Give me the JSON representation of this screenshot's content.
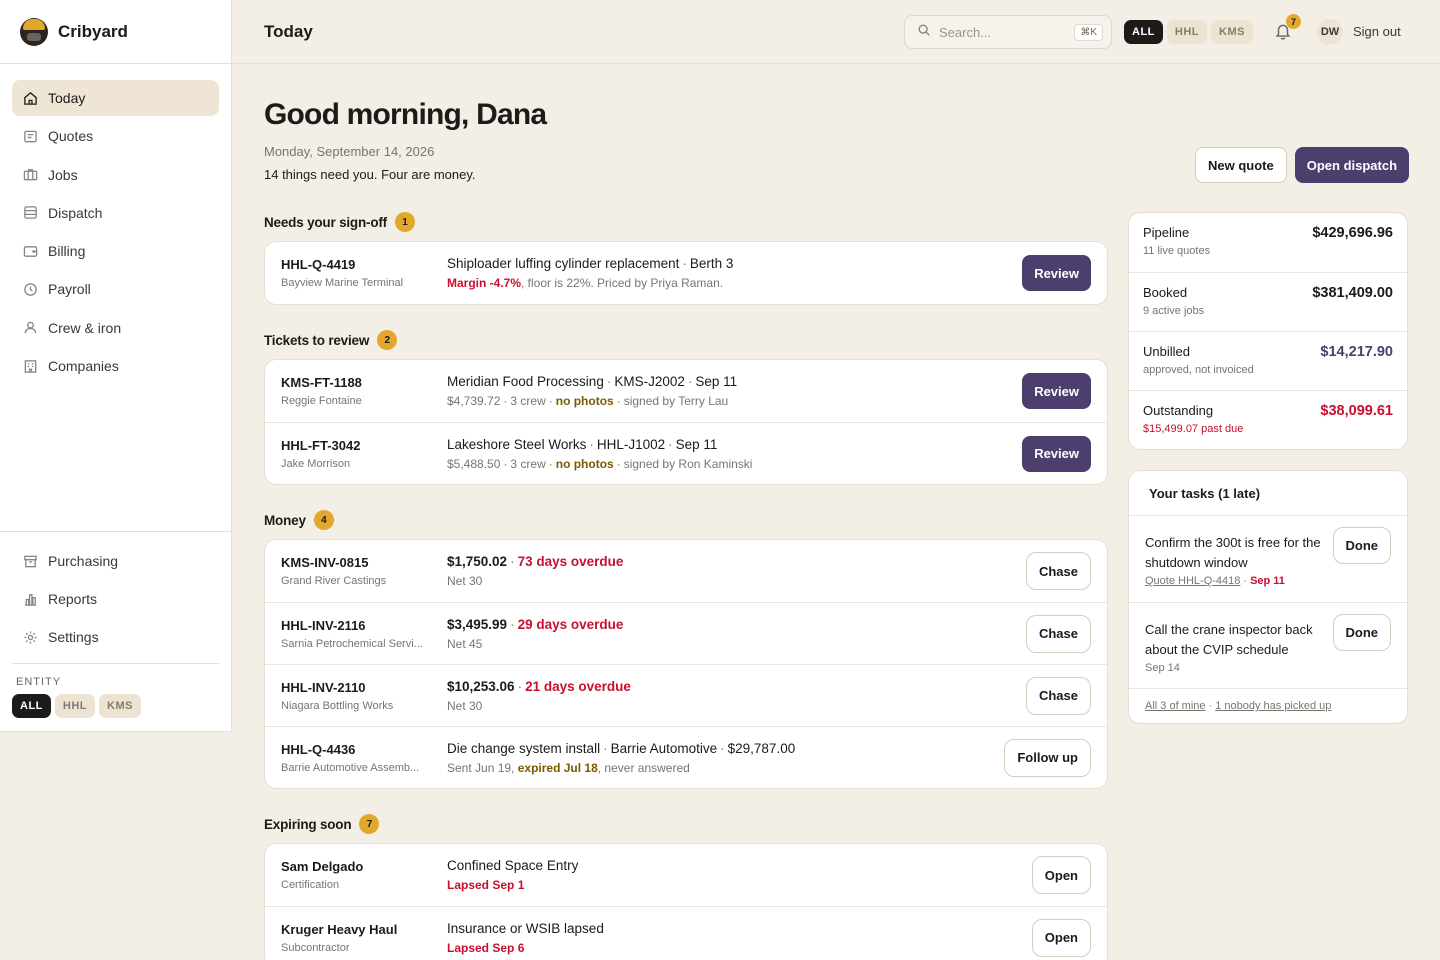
{
  "brand": {
    "name": "Cribyard"
  },
  "sidebar": {
    "items": [
      {
        "label": "Today",
        "icon": "home-icon",
        "active": true
      },
      {
        "label": "Quotes",
        "icon": "quote-icon"
      },
      {
        "label": "Jobs",
        "icon": "briefcase-icon"
      },
      {
        "label": "Dispatch",
        "icon": "dispatch-icon"
      },
      {
        "label": "Billing",
        "icon": "billing-icon"
      },
      {
        "label": "Payroll",
        "icon": "clock-icon"
      },
      {
        "label": "Crew & iron",
        "icon": "user-icon"
      },
      {
        "label": "Companies",
        "icon": "building-icon"
      }
    ],
    "lower_items": [
      {
        "label": "Purchasing",
        "icon": "box-icon"
      },
      {
        "label": "Reports",
        "icon": "chart-icon"
      },
      {
        "label": "Settings",
        "icon": "gear-icon"
      }
    ],
    "entity_label": "ENTITY",
    "entity_pills": [
      "ALL",
      "HHL",
      "KMS"
    ]
  },
  "header": {
    "title": "Today",
    "search_placeholder": "Search...",
    "search_shortcut": "⌘K",
    "entity_pills": [
      "ALL",
      "HHL",
      "KMS"
    ],
    "notifications": "7",
    "avatar": "DW",
    "signout": "Sign out"
  },
  "main": {
    "greeting": "Good morning, Dana",
    "date": "Monday, September 14, 2026",
    "summary": "14 things need you. Four are money.",
    "new_quote": "New quote",
    "open_dispatch": "Open dispatch",
    "signoff": {
      "title": "Needs your sign-off",
      "count": "1",
      "rows": [
        {
          "id": "HHL-Q-4419",
          "sub": "Bayview Marine Terminal",
          "title": "Shiploader luffing cylinder replacement",
          "title2": "Berth 3",
          "margin": "Margin -4.7%",
          "detail": ", floor is 22%. Priced by Priya Raman.",
          "action": "Review"
        }
      ]
    },
    "tickets": {
      "title": "Tickets to review",
      "count": "2",
      "rows": [
        {
          "id": "KMS-FT-1188",
          "sub": "Reggie Fontaine",
          "t1": "Meridian Food Processing",
          "t2": "KMS-J2002",
          "t3": "Sep 11",
          "amount": "$4,739.72",
          "crew": "3 crew",
          "flag": "no photos",
          "signed": "signed by Terry Lau",
          "action": "Review"
        },
        {
          "id": "HHL-FT-3042",
          "sub": "Jake Morrison",
          "t1": "Lakeshore Steel Works",
          "t2": "HHL-J1002",
          "t3": "Sep 11",
          "amount": "$5,488.50",
          "crew": "3 crew",
          "flag": "no photos",
          "signed": "signed by Ron Kaminski",
          "action": "Review"
        }
      ]
    },
    "money": {
      "title": "Money",
      "count": "4",
      "rows": [
        {
          "id": "KMS-INV-0815",
          "sub": "Grand River Castings",
          "amount": "$1,750.02",
          "overdue": "73 days overdue",
          "detail": "Net 30",
          "action": "Chase"
        },
        {
          "id": "HHL-INV-2116",
          "sub": "Sarnia Petrochemical Servi...",
          "amount": "$3,495.99",
          "overdue": "29 days overdue",
          "detail": "Net 45",
          "action": "Chase"
        },
        {
          "id": "HHL-INV-2110",
          "sub": "Niagara Bottling Works",
          "amount": "$10,253.06",
          "overdue": "21 days overdue",
          "detail": "Net 30",
          "action": "Chase"
        }
      ],
      "quote_row": {
        "id": "HHL-Q-4436",
        "sub": "Barrie Automotive Assemb...",
        "t1": "Die change system install",
        "t2": "Barrie Automotive",
        "t3": "$29,787.00",
        "sent": "Sent Jun 19, ",
        "expired": "expired Jul 18",
        "never": ", never answered",
        "action": "Follow up"
      }
    },
    "expiring": {
      "title": "Expiring soon",
      "count": "7",
      "rows": [
        {
          "id": "Sam Delgado",
          "sub": "Certification",
          "title": "Confined Space Entry",
          "status": "Lapsed Sep 1",
          "action": "Open"
        },
        {
          "id": "Kruger Heavy Haul",
          "sub": "Subcontractor",
          "title": "Insurance or WSIB lapsed",
          "status": "Lapsed Sep 6",
          "action": "Open"
        }
      ]
    }
  },
  "stats": [
    {
      "label": "Pipeline",
      "sub": "11 live quotes",
      "value": "$429,696.96",
      "tone": ""
    },
    {
      "label": "Booked",
      "sub": "9 active jobs",
      "value": "$381,409.00",
      "tone": ""
    },
    {
      "label": "Unbilled",
      "sub": "approved, not invoiced",
      "value": "$14,217.90",
      "tone": "purple"
    },
    {
      "label": "Outstanding",
      "sub": "$15,499.07 past due",
      "value": "$38,099.61",
      "tone": "red"
    }
  ],
  "tasks": {
    "title": "Your tasks (1 late)",
    "items": [
      {
        "text": "Confirm the 300t is free for the shutdown window",
        "link": "Quote HHL-Q-4418",
        "date": "Sep 11",
        "late": true,
        "action": "Done"
      },
      {
        "text": "Call the crane inspector back about the CVIP schedule",
        "link": "",
        "date": "Sep 14",
        "late": false,
        "action": "Done"
      }
    ],
    "foot_mine": "All 3 of mine",
    "foot_nobody": "1 nobody has picked up"
  },
  "colors": {
    "accent": "#4c3f6e",
    "warning": "#e3a82b",
    "danger": "#c8102e",
    "background": "#f4efe6"
  }
}
